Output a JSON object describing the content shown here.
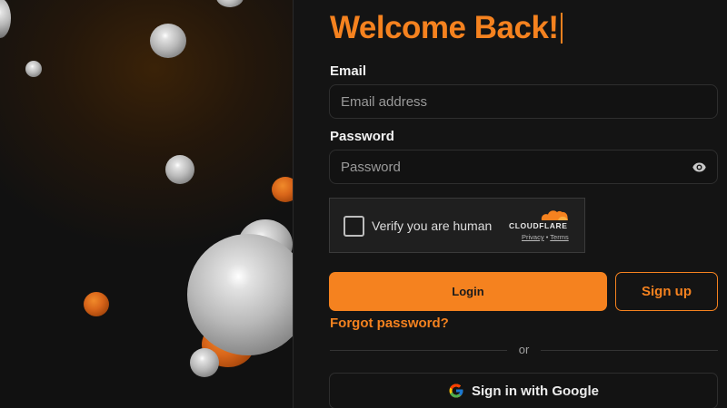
{
  "header": {
    "title": "Welcome Back!"
  },
  "form": {
    "email_label": "Email",
    "email_placeholder": "Email address",
    "email_value": "",
    "password_label": "Password",
    "password_placeholder": "Password",
    "password_value": ""
  },
  "captcha": {
    "label": "Verify you are human",
    "brand": "CLOUDFLARE",
    "privacy_link": "Privacy",
    "separator": "•",
    "terms_link": "Terms",
    "checked": false
  },
  "actions": {
    "login_label": "Login",
    "signup_label": "Sign up",
    "forgot_label": "Forgot password?",
    "or_text": "or",
    "google_label": "Sign in with Google"
  },
  "icons": {
    "password_toggle": "eye-icon",
    "google": "google-icon",
    "cloudflare": "cloudflare-cloud-icon"
  },
  "colors": {
    "accent": "#f5821f",
    "background": "#141414",
    "sphere_white": "#c8c8c8",
    "sphere_orange": "#d9661a"
  }
}
